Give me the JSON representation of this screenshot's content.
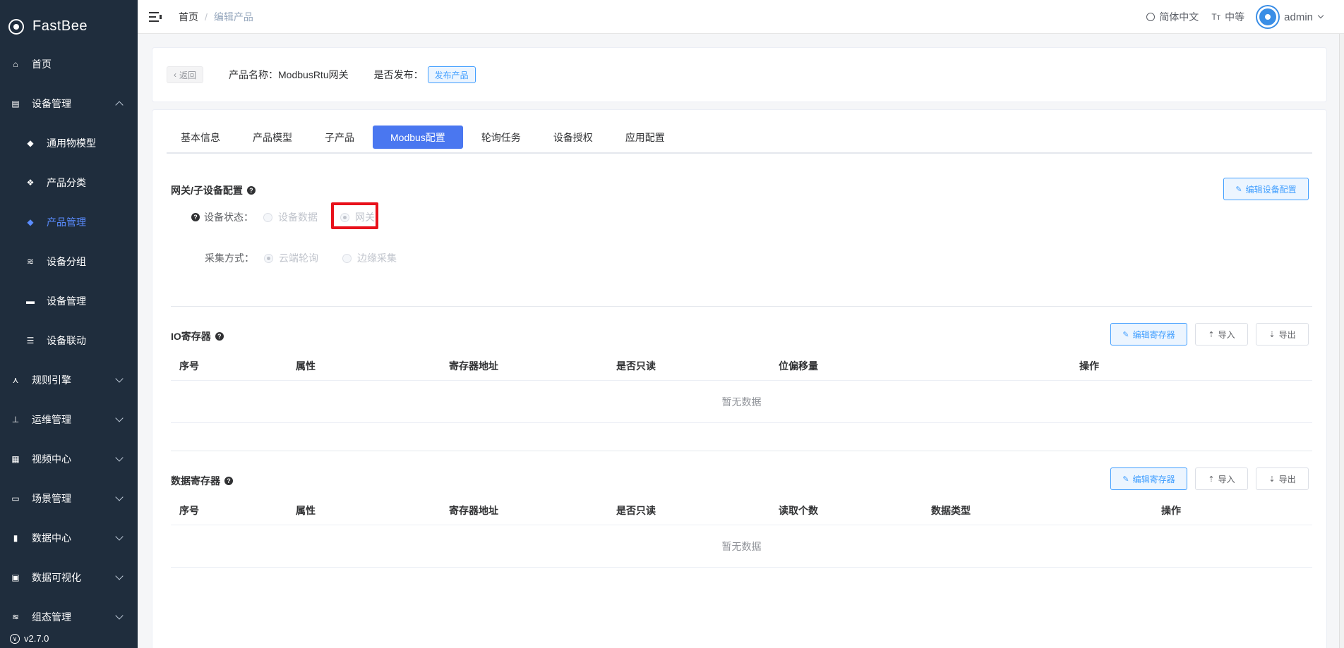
{
  "app": {
    "name": "FastBee",
    "version": "v2.7.0"
  },
  "sidebar": {
    "items": [
      {
        "label": "首页",
        "icon": "home-icon"
      },
      {
        "label": "设备管理",
        "icon": "device-icon",
        "expanded": true
      },
      {
        "label": "通用物模型",
        "icon": "cube-icon"
      },
      {
        "label": "产品分类",
        "icon": "category-icon"
      },
      {
        "label": "产品管理",
        "icon": "product-icon",
        "active": true
      },
      {
        "label": "设备分组",
        "icon": "layers-icon"
      },
      {
        "label": "设备管理",
        "icon": "server-icon"
      },
      {
        "label": "设备联动",
        "icon": "link-icon"
      },
      {
        "label": "规则引擎",
        "icon": "rule-icon"
      },
      {
        "label": "运维管理",
        "icon": "ops-icon"
      },
      {
        "label": "视频中心",
        "icon": "video-icon"
      },
      {
        "label": "场景管理",
        "icon": "scene-icon"
      },
      {
        "label": "数据中心",
        "icon": "chart-icon"
      },
      {
        "label": "数据可视化",
        "icon": "monitor-icon"
      },
      {
        "label": "组态管理",
        "icon": "stack-icon"
      }
    ]
  },
  "topbar": {
    "breadcrumb": {
      "home": "首页",
      "current": "编辑产品"
    },
    "language": "简体中文",
    "size": "中等",
    "size_icon": "Tт",
    "user": "admin"
  },
  "header_card": {
    "back": "返回",
    "product_name_label": "产品名称：ModbusRtu网关",
    "publish_label": "是否发布：",
    "publish_button": "发布产品"
  },
  "tabs": [
    "基本信息",
    "产品模型",
    "子产品",
    "Modbus配置",
    "轮询任务",
    "设备授权",
    "应用配置"
  ],
  "active_tab": "Modbus配置",
  "gateway_config": {
    "title": "网关/子设备配置",
    "edit_button": "编辑设备配置",
    "status_label": "设备状态：",
    "status_options": [
      "设备数据",
      "网关"
    ],
    "status_selected": "网关",
    "collect_label": "采集方式：",
    "collect_options": [
      "云端轮询",
      "边缘采集"
    ],
    "collect_selected": "云端轮询"
  },
  "io_register": {
    "title": "IO寄存器",
    "edit_button": "编辑寄存器",
    "import_button": "导入",
    "export_button": "导出",
    "columns": [
      "序号",
      "属性",
      "寄存器地址",
      "是否只读",
      "位偏移量",
      "操作"
    ],
    "empty_text": "暂无数据"
  },
  "data_register": {
    "title": "数据寄存器",
    "edit_button": "编辑寄存器",
    "import_button": "导入",
    "export_button": "导出",
    "columns": [
      "序号",
      "属性",
      "寄存器地址",
      "是否只读",
      "读取个数",
      "数据类型",
      "操作"
    ],
    "empty_text": "暂无数据"
  },
  "colors": {
    "sidebar_bg": "#1f2d3d",
    "primary": "#4a77f0",
    "active_menu": "#5a8cff",
    "highlight": "#e8111b"
  }
}
